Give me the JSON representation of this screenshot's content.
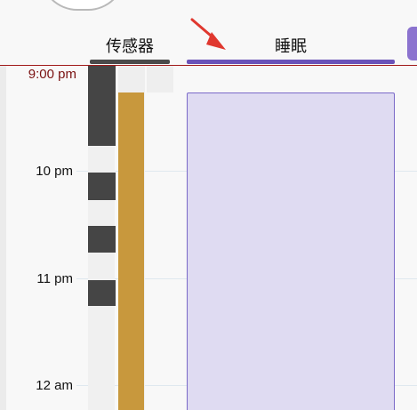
{
  "tabs": {
    "sensors_label": "传感器",
    "sleep_label": "睡眠"
  },
  "timeline": {
    "current_time_label": "9:00 pm",
    "hour_labels": [
      "10 pm",
      "11 pm",
      "12 am"
    ]
  },
  "colors": {
    "current_time": "#7a1111",
    "sleep_fill": "#dfdbf2",
    "sleep_border": "#7a69c8",
    "sensor_gold": "#c8983d",
    "sensor_dark": "#454545",
    "active_tab_underline": "#6b53b9",
    "arrow": "#e0382f"
  },
  "icons": {
    "annotation_arrow": "red-arrow-icon"
  }
}
